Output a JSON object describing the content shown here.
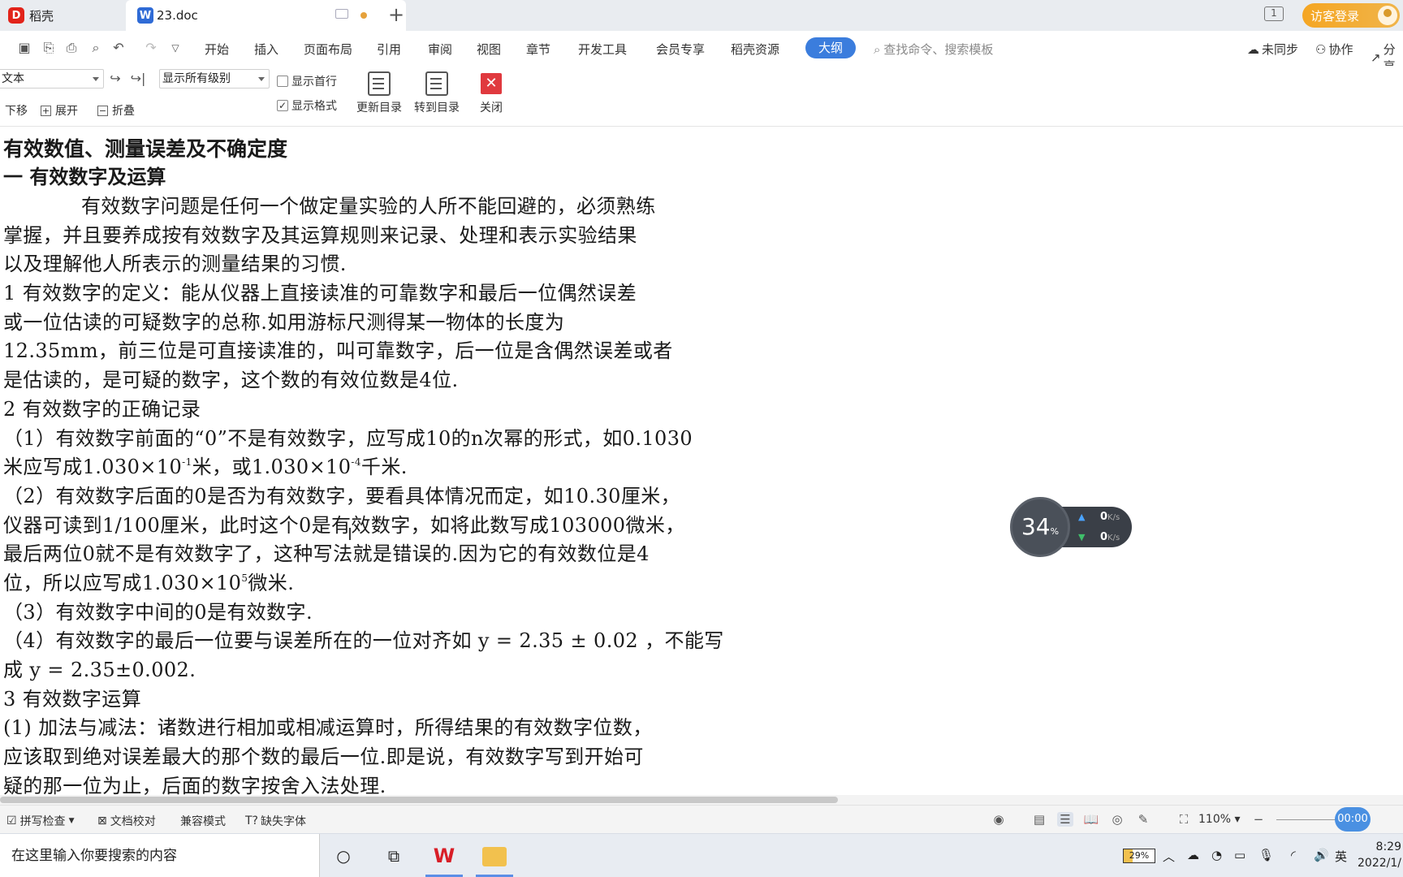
{
  "tabs": {
    "home_label": "稻壳",
    "doc_label": "23.doc",
    "page_indicator": "1",
    "login_label": "访客登录"
  },
  "menu": {
    "items": [
      "开始",
      "插入",
      "页面布局",
      "引用",
      "审阅",
      "视图",
      "章节",
      "开发工具",
      "会员专享",
      "稻壳资源"
    ],
    "active": "大纲",
    "search_placeholder": "查找命令、搜索模板",
    "sync_label": "未同步",
    "collab_label": "协作",
    "share_label": "分享"
  },
  "ribbon": {
    "style_value": "文本",
    "level_value": "显示所有级别",
    "show_first_line": "显示首行",
    "show_format": "显示格式",
    "move_down": "下移",
    "expand": "展开",
    "collapse": "折叠",
    "update_toc": "更新目录",
    "goto_toc": "转到目录",
    "close": "关闭"
  },
  "document": {
    "title": "有效数值、测量误差及不确定度",
    "section1": "一 有效数字及运算",
    "lines": {
      "p1a": "有效数字问题是任何一个做定量实验的人所不能回避的，必须熟练",
      "p1b": "掌握，并且要养成按有效数字及其运算规则来记录、处理和表示实验结果",
      "p1c": "以及理解他人所表示的测量结果的习惯.",
      "d1a": "1 有效数字的定义：能从仪器上直接读准的可靠数字和最后一位偶然误差",
      "d1b": "或一位估读的可疑数字的总称.如用游标尺测得某一物体的长度为",
      "d1c": "12.35mm，前三位是可直接读准的，叫可靠数字，后一位是含偶然误差或者",
      "d1d": "是估读的，是可疑的数字，这个数的有效位数是4位.",
      "s2": "2 有效数字的正确记录",
      "r1a": "（1）有效数字前面的“0”不是有效数字，应写成10的n次幂的形式，如0.1030",
      "r1b_1": "米应写成1.030×10",
      "r1b_sup1": "-1",
      "r1b_2": "米，或1.030×10",
      "r1b_sup2": "-4",
      "r1b_3": "千米.",
      "r2a": "（2）有效数字后面的0是否为有效数字，要看具体情况而定，如10.30厘米，",
      "r2b": "仪器可读到1/100厘米，此时这个0是有效数字，如将此数写成103000微米，",
      "r2c": "最后两位0就不是有效数字了，这种写法就是错误的.因为它的有效数位是4",
      "r2d_1": "位，所以应写成1.030×10",
      "r2d_sup": "5",
      "r2d_2": "微米.",
      "r3": "（3）有效数字中间的0是有效数字.",
      "r4a": "（4）有效数字的最后一位要与误差所在的一位对齐如 y = 2.35 ± 0.02 ，不能写",
      "r4b": "成 y = 2.35±0.002.",
      "s3": "3 有效数字运算",
      "o1a": "(1) 加法与减法：诸数进行相加或相减运算时，所得结果的有效数字位数，",
      "o1b": "应该取到绝对误差最大的那个数的最后一位.即是说，有效数字写到开始可",
      "o1c": "疑的那一位为止，后面的数字按舍入法处理."
    }
  },
  "speed_widget": {
    "percent": "34",
    "percent_sign": "%",
    "up_value": "0",
    "down_value": "0",
    "unit": "K/s"
  },
  "statusbar": {
    "spell_check": "拼写检查",
    "doc_proof": "文档校对",
    "compat_mode": "兼容模式",
    "missing_font": "缺失字体",
    "zoom": "110%",
    "timer": "00:00"
  },
  "taskbar": {
    "search_placeholder": "在这里输入你要搜索的内容",
    "battery": "29%",
    "ime": "英",
    "time": "8:29",
    "date": "2022/1/"
  }
}
